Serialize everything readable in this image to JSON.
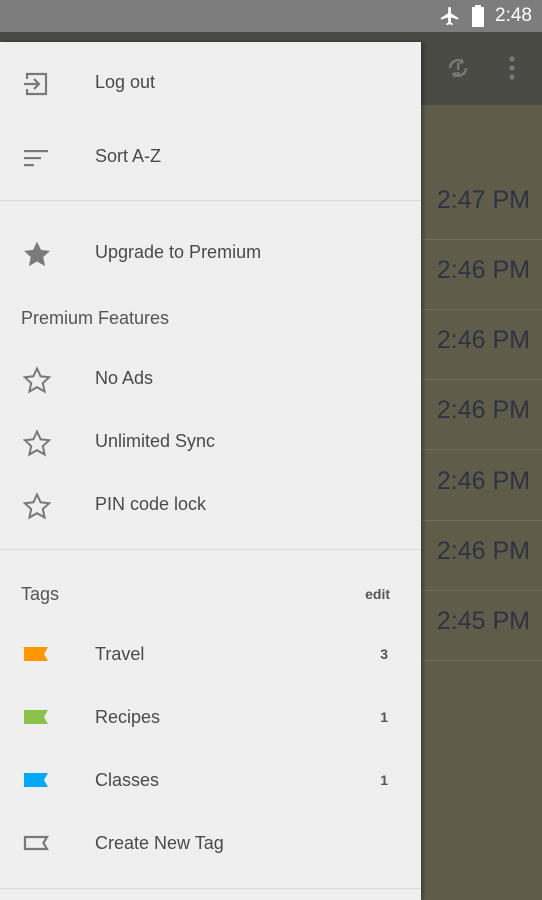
{
  "status_bar": {
    "time": "2:48",
    "icons": [
      "airplane-icon",
      "battery-icon"
    ]
  },
  "app": {
    "toolbar_icons": [
      "sync-icon",
      "more-vert-icon"
    ],
    "note_times": [
      "2:47 PM",
      "2:46 PM",
      "2:46 PM",
      "2:46 PM",
      "2:46 PM",
      "2:46 PM",
      "2:45 PM"
    ]
  },
  "drawer": {
    "top_items": [
      {
        "label": "Log out",
        "icon": "logout-icon"
      },
      {
        "label": "Sort A-Z",
        "icon": "sort-icon"
      }
    ],
    "upgrade": {
      "label": "Upgrade to Premium",
      "icon": "star-filled-icon"
    },
    "premium_header": "Premium Features",
    "premium_items": [
      {
        "label": "No Ads",
        "icon": "star-outline-icon"
      },
      {
        "label": "Unlimited Sync",
        "icon": "star-outline-icon"
      },
      {
        "label": "PIN code lock",
        "icon": "star-outline-icon"
      }
    ],
    "tags_header": "Tags",
    "tags_edit": "edit",
    "tags": [
      {
        "label": "Travel",
        "count": "3",
        "color": "#ff9800"
      },
      {
        "label": "Recipes",
        "count": "1",
        "color": "#8bc34a"
      },
      {
        "label": "Classes",
        "count": "1",
        "color": "#03a9f4"
      }
    ],
    "create_tag": {
      "label": "Create New Tag",
      "icon": "tag-outline-icon"
    }
  }
}
